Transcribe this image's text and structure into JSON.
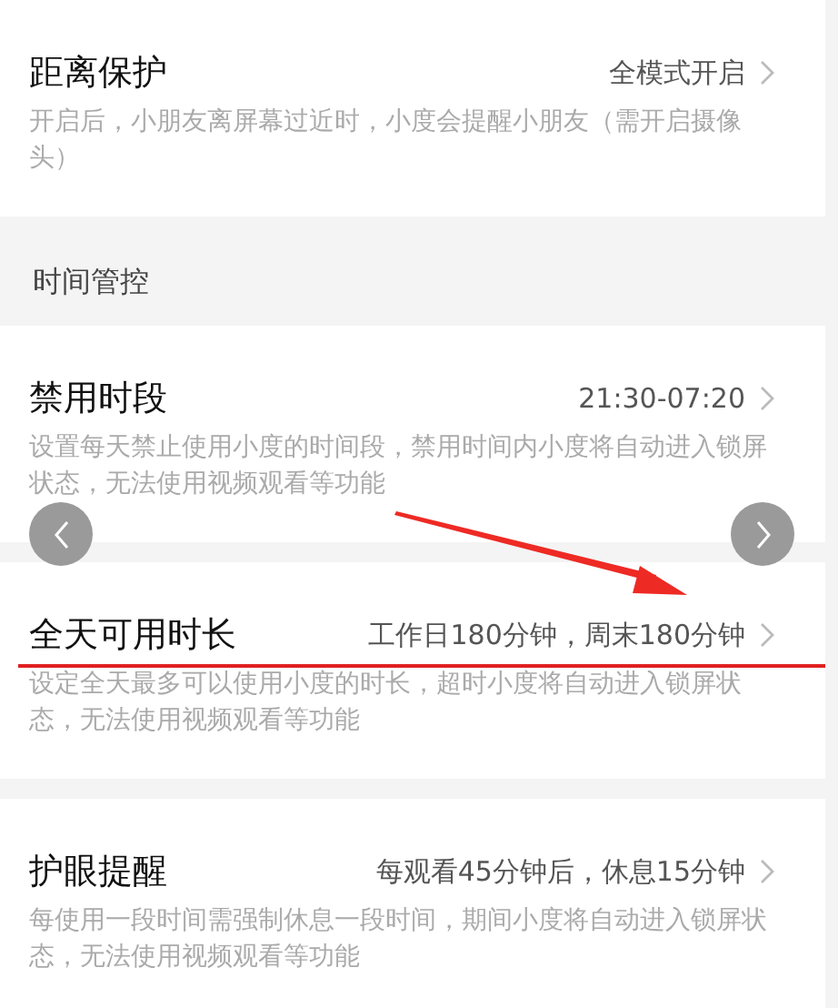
{
  "rows": [
    {
      "kind": "setting",
      "title": "距离保护",
      "value": "全模式开启",
      "description": "开启后，小朋友离屏幕过近时，小度会提醒小朋友（需开启摄像头）",
      "annotated": false
    },
    {
      "kind": "section",
      "title": "时间管控"
    },
    {
      "kind": "setting",
      "title": "禁用时段",
      "value": "21:30-07:20",
      "description": "设置每天禁止使用小度的时间段，禁用时间内小度将自动进入锁屏状态，无法使用视频观看等功能",
      "annotated": false
    },
    {
      "kind": "setting",
      "title": "全天可用时长",
      "value": "工作日180分钟，周末180分钟",
      "description": "设定全天最多可以使用小度的时长，超时小度将自动进入锁屏状态，无法使用视频观看等功能",
      "annotated": true
    },
    {
      "kind": "setting",
      "title": "护眼提醒",
      "value": "每观看45分钟后，休息15分钟",
      "description": "每使用一段时间需强制休息一段时间，期间小度将自动进入锁屏状态，无法使用视频观看等功能",
      "annotated": false
    }
  ]
}
